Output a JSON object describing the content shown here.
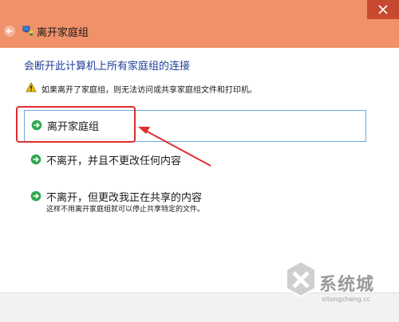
{
  "window": {
    "title": "离开家庭组",
    "back_icon": "back-arrow-icon",
    "app_icon": "homegroup-icon",
    "close_icon": "close-icon",
    "titlebar_color": "#f0916a",
    "close_color": "#c7492f"
  },
  "content": {
    "heading": "会断开此计算机上所有家庭组的连接",
    "heading_color": "#1f3d99",
    "warning_icon": "warning-icon",
    "warning": "如果离开了家庭组，则无法访问或共享家庭组文件和打印机。"
  },
  "options": [
    {
      "icon": "green-arrow-icon",
      "label": "离开家庭组",
      "selected": true
    },
    {
      "icon": "green-arrow-icon",
      "label": "不离开，并且不更改任何内容"
    },
    {
      "icon": "green-arrow-icon",
      "label": "不离开，但更改我正在共享的内容",
      "description": "这样不用离开家庭组就可以停止共享特定的文件。"
    }
  ],
  "annotation": {
    "color": "#e02e2e"
  },
  "watermark": {
    "text": "系统城",
    "url": "xitongcheng.cc"
  }
}
